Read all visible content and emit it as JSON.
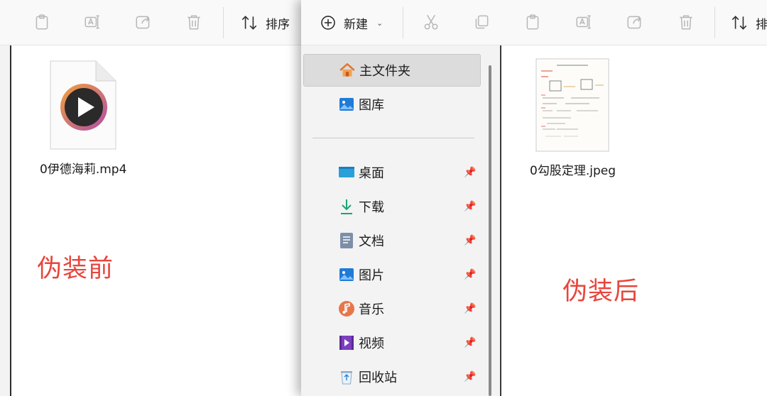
{
  "left_window": {
    "toolbar": {
      "sort_label": "排序",
      "buttons": [
        "paste-icon",
        "rename-icon",
        "share-icon",
        "delete-icon"
      ]
    },
    "file": {
      "name": "0伊德海莉.mp4",
      "type_icon": "video-file-icon"
    },
    "annotation": "伪装前"
  },
  "front_window": {
    "toolbar": {
      "new_label": "新建",
      "sort_label": "排",
      "buttons": [
        "cut-icon",
        "copy-icon",
        "paste-icon",
        "rename-icon",
        "share-icon",
        "delete-icon"
      ]
    },
    "nav": {
      "top_items": [
        {
          "label": "主文件夹",
          "icon": "home-icon",
          "selected": true
        },
        {
          "label": "图库",
          "icon": "gallery-icon",
          "selected": false
        }
      ],
      "pinned_items": [
        {
          "label": "桌面",
          "icon": "desktop-icon"
        },
        {
          "label": "下载",
          "icon": "download-icon"
        },
        {
          "label": "文档",
          "icon": "documents-icon"
        },
        {
          "label": "图片",
          "icon": "pictures-icon"
        },
        {
          "label": "音乐",
          "icon": "music-icon"
        },
        {
          "label": "视频",
          "icon": "videos-icon"
        },
        {
          "label": "回收站",
          "icon": "recycle-bin-icon"
        }
      ]
    },
    "file": {
      "name": "0勾股定理.jpeg",
      "type_icon": "image-thumbnail"
    },
    "annotation": "伪装后"
  },
  "colors": {
    "annotation": "#e8453c",
    "selection": "#dcdcdc",
    "accent": "#0067c0"
  }
}
